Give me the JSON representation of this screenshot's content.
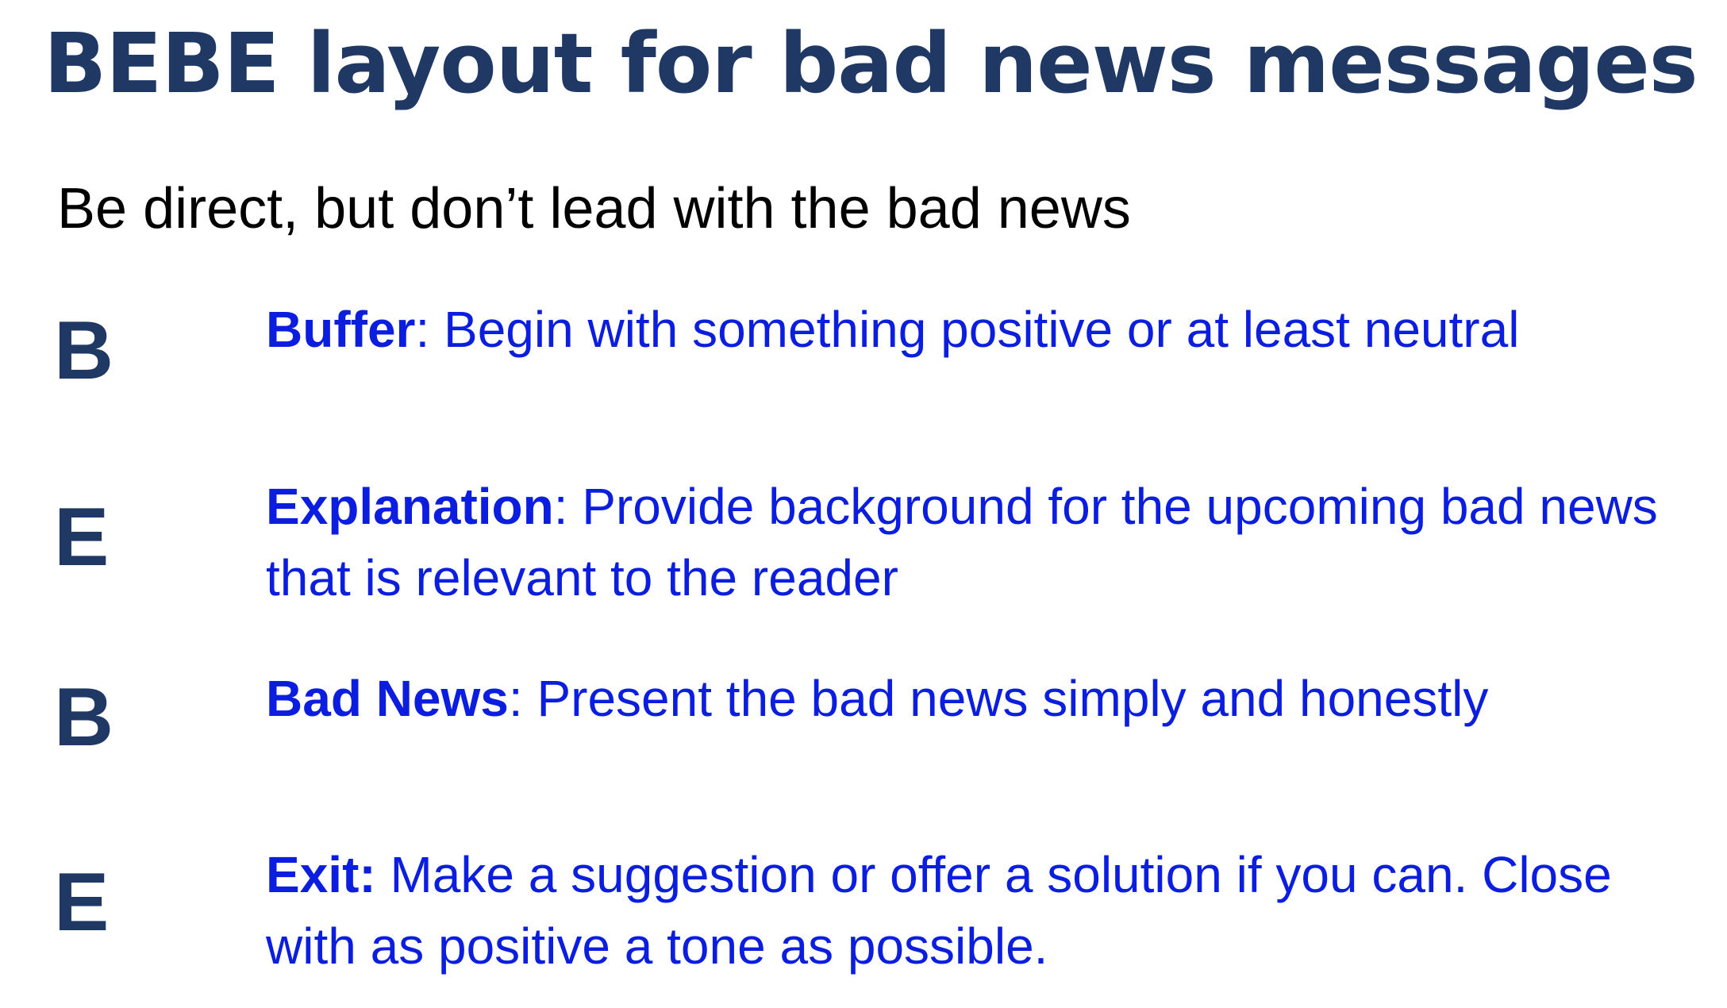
{
  "slide": {
    "title": "BEBE layout for bad news messages",
    "subtitle": "Be direct, but don’t lead with the bad news",
    "steps": [
      {
        "letter": "B",
        "term": "Buffer",
        "separator": ":",
        "text": " Begin with something positive or at least neutral"
      },
      {
        "letter": "E",
        "term": "Explanation",
        "separator": ":",
        "text": " Provide background for the upcoming bad news that is relevant to the reader"
      },
      {
        "letter": "B",
        "term": "Bad News",
        "separator": ":",
        "text": " Present the bad news simply and honestly"
      },
      {
        "letter": "E",
        "term": "Exit:",
        "separator": "",
        "text": " Make a suggestion or offer a solution if you can. Close with as positive a tone as possible."
      }
    ]
  },
  "colors": {
    "title": "#1f3864",
    "letters": "#1f3864",
    "body_text": "#0b1ee0",
    "subtitle": "#000000",
    "background": "#ffffff"
  }
}
